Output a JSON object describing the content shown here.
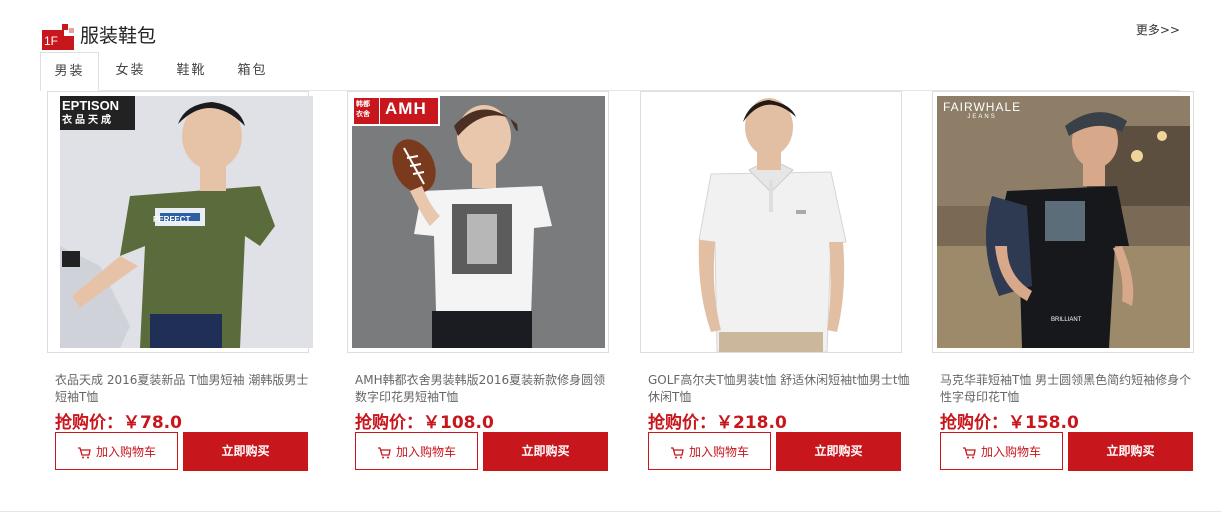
{
  "floor": {
    "badge_number": "1F",
    "title": "服装鞋包",
    "more_label": "更多>>"
  },
  "tabs": [
    {
      "label": "男装",
      "active": true
    },
    {
      "label": "女装",
      "active": false
    },
    {
      "label": "鞋靴",
      "active": false
    },
    {
      "label": "箱包",
      "active": false
    }
  ],
  "products": [
    {
      "name": "衣品天成 2016夏装新品 T恤男短袖 潮韩版男士短袖T恤",
      "price": "抢购价：￥78.0",
      "brand_logo": "EPTISON",
      "brand_sub": "衣品天成",
      "shirt_print": "PERFECT",
      "cart_label": "加入购物车",
      "buy_label": "立即购买"
    },
    {
      "name": "AMH韩都衣舍男装韩版2016夏装新款修身圆领数字印花男短袖T恤",
      "price": "抢购价：￥108.0",
      "brand_logo": "AMH",
      "brand_sub": "韩都\n衣舍",
      "cart_label": "加入购物车",
      "buy_label": "立即购买"
    },
    {
      "name": "GOLF高尔夫T恤男装t恤 舒适休闲短袖t恤男士t恤休闲T恤",
      "price": "抢购价：￥218.0",
      "cart_label": "加入购物车",
      "buy_label": "立即购买"
    },
    {
      "name": "马克华菲短袖T恤 男士圆领黑色简约短袖修身个性字母印花T恤",
      "price": "抢购价：￥158.0",
      "brand_logo": "FAIRWHALE",
      "brand_sub": "JEANS",
      "shirt_print": "BRILLIANT",
      "cart_label": "加入购物车",
      "buy_label": "立即购买"
    }
  ],
  "colors": {
    "accent": "#c8161d"
  }
}
